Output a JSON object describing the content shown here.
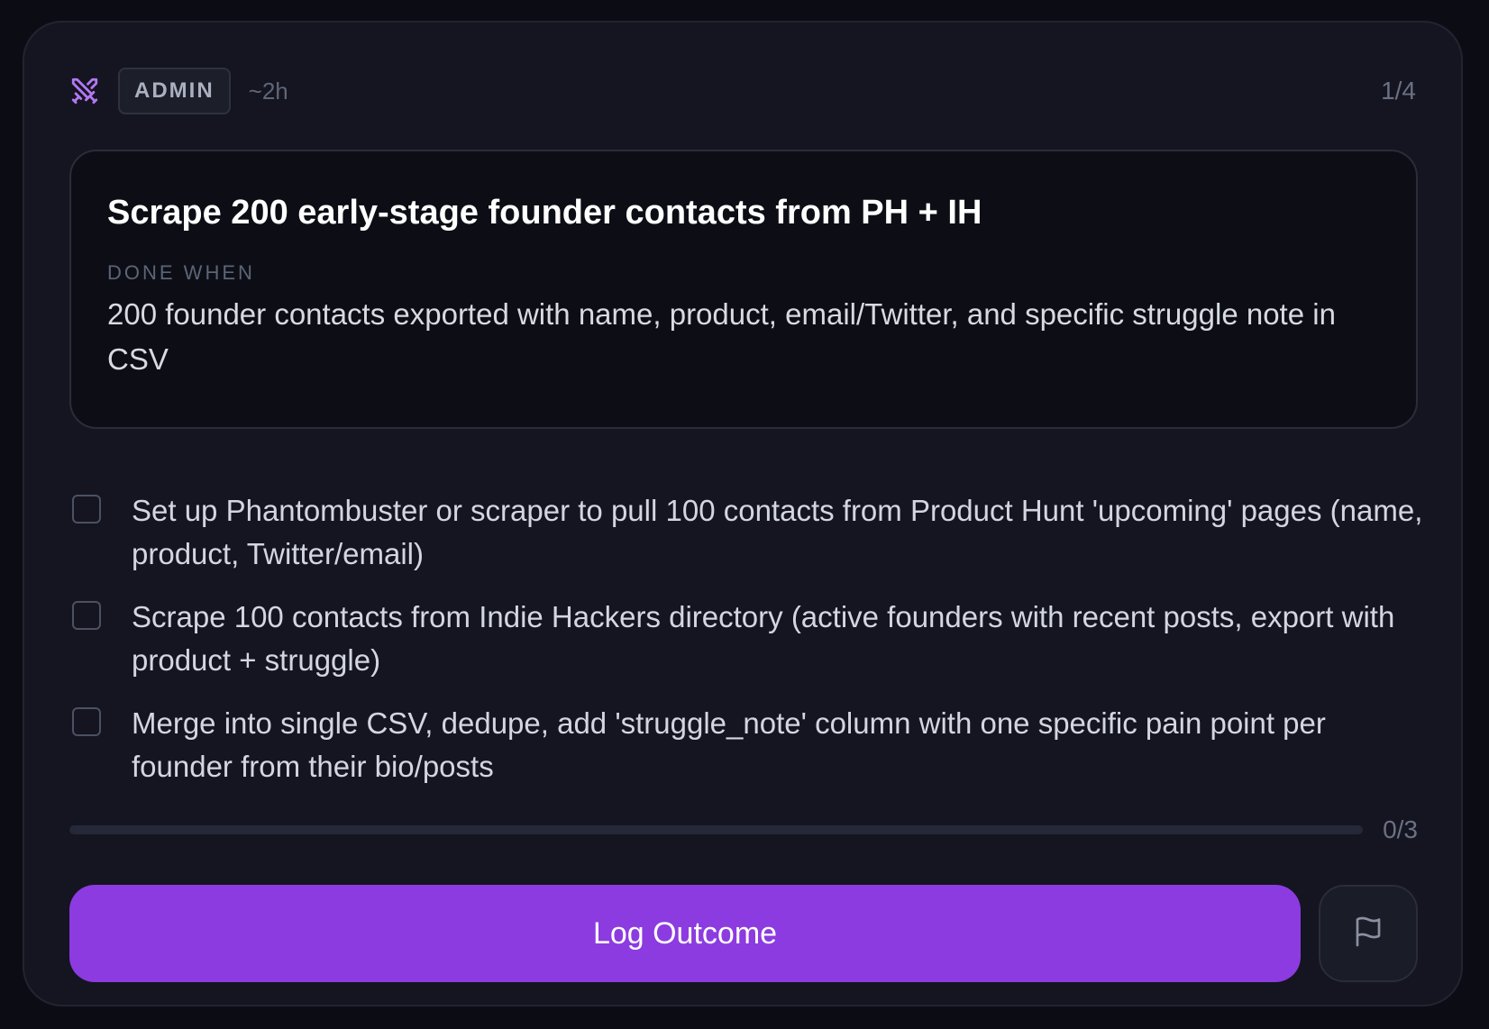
{
  "header": {
    "icon": "crossed-swords-icon",
    "badge": "ADMIN",
    "duration": "~2h",
    "step_counter": "1/4"
  },
  "task": {
    "title": "Scrape 200 early-stage founder contacts from PH + IH",
    "done_when_label": "DONE WHEN",
    "done_when_text": "200 founder contacts exported with name, product, email/Twitter, and specific struggle note in CSV"
  },
  "checklist": [
    {
      "text": "Set up Phantombuster or scraper to pull 100 contacts from Product Hunt 'upcoming' pages (name, product, Twitter/email)",
      "checked": false
    },
    {
      "text": "Scrape 100 contacts from Indie Hackers directory (active founders with recent posts, export with product + struggle)",
      "checked": false
    },
    {
      "text": "Merge into single CSV, dedupe, add 'struggle_note' column with one specific pain point per founder from their bio/posts",
      "checked": false
    }
  ],
  "progress": {
    "label": "0/3",
    "fraction": 0
  },
  "actions": {
    "primary_label": "Log Outcome",
    "secondary_icon": "flag-icon"
  },
  "colors": {
    "accent": "#8c3be0",
    "icon_accent": "#b278f2",
    "background": "#0c0d14",
    "card": "#141520"
  }
}
